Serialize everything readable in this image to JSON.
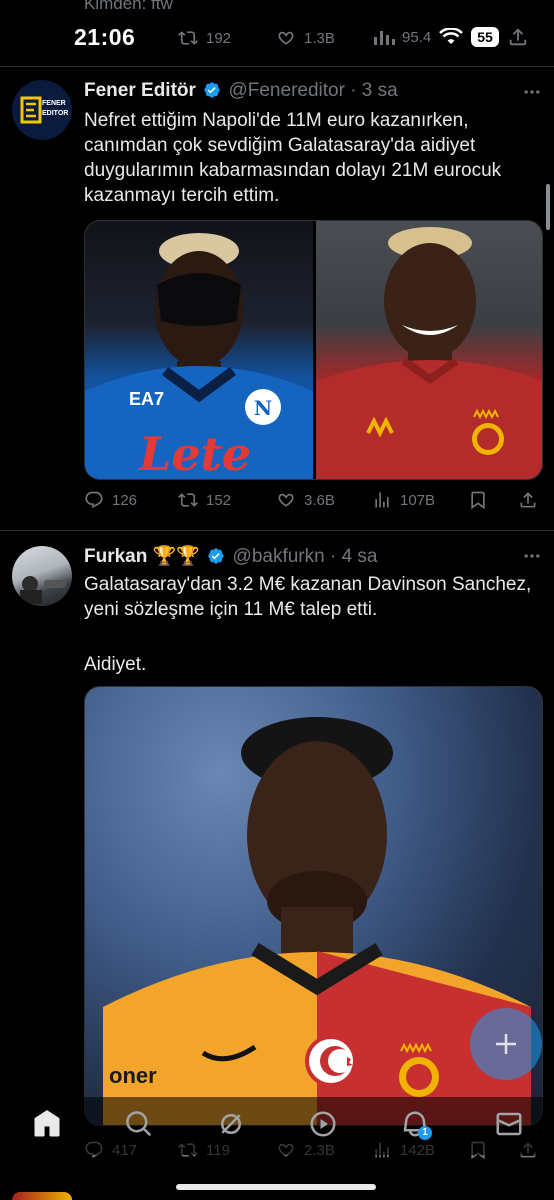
{
  "previous_tweet": {
    "partial_text": "Kimden: ftw",
    "retweets": "192",
    "likes": "1.3B",
    "views": "95.4"
  },
  "status_bar": {
    "time": "21:06",
    "battery": "55"
  },
  "tweets": [
    {
      "name": "Fener Editör",
      "handle": "@Fenereditor",
      "time": "· 3 sa",
      "text": "Nefret ettiğim Napoli'de 11M euro kazanırken, canımdan çok sevdiğim Galatasaray'da aidiyet duygularımın kabarmasından dolayı 21M eurocuk kazanmayı tercih ettim.",
      "avatar_text_top": "FENER",
      "avatar_text_bottom": "EDITOR",
      "replies": "126",
      "retweets": "152",
      "likes": "3.6B",
      "views": "107B",
      "media_left_shirt_text": "EA7",
      "media_left_sponsor": "Lete"
    },
    {
      "name": "Furkan",
      "trophies": "🏆🏆",
      "handle": "@bakfurkn",
      "time": "· 4 sa",
      "text_line1": "Galatasaray'dan 3.2 M€ kazanan Davinson Sanchez, yeni sözleşme için 11 M€ talep etti.",
      "text_line2": "Aidiyet.",
      "replies": "417",
      "retweets": "119",
      "likes": "2.3B",
      "views": "142B",
      "media_sponsor": "oner"
    }
  ],
  "bottom_nav": {
    "notifications_badge": "1"
  },
  "colors": {
    "background": "#000000",
    "text": "#e7e9ea",
    "muted": "#71767b",
    "accent": "#1d9bf0",
    "divider": "#2f3336"
  },
  "icons": [
    "retweet-icon",
    "heart-icon",
    "views-icon",
    "bookmark-icon",
    "share-icon",
    "reply-icon",
    "verified-icon",
    "home-icon",
    "search-icon",
    "grok-icon",
    "spaces-icon",
    "bell-icon",
    "mail-icon",
    "plus-icon"
  ]
}
